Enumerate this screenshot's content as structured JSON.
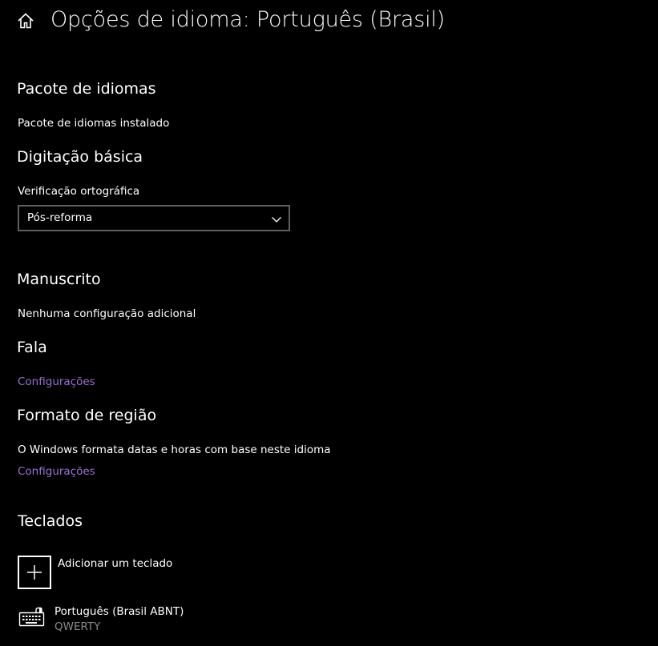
{
  "header": {
    "title": "Opções de idioma: Português (Brasil)",
    "home_icon": "home-icon"
  },
  "language_pack": {
    "title": "Pacote de idiomas",
    "status": "Pacote de idiomas instalado"
  },
  "basic_typing": {
    "title": "Digitação básica",
    "spellcheck_label": "Verificação ortográfica",
    "spellcheck_value": "Pós-reforma"
  },
  "handwriting": {
    "title": "Manuscrito",
    "status": "Nenhuma configuração adicional"
  },
  "speech": {
    "title": "Fala",
    "link": "Configurações"
  },
  "region_format": {
    "title": "Formato de região",
    "description": "O Windows formata datas e horas com base neste idioma",
    "link": "Configurações"
  },
  "keyboards": {
    "title": "Teclados",
    "add_label": "Adicionar um teclado",
    "items": [
      {
        "name": "Português (Brasil ABNT)",
        "layout": "QWERTY",
        "icon": "keyboard-icon"
      }
    ]
  },
  "colors": {
    "background": "#000000",
    "link": "#9a6fd6",
    "secondary_text": "#8a8a8a"
  }
}
